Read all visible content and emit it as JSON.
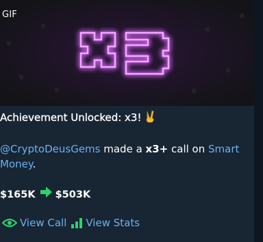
{
  "media": {
    "badge": "GIF",
    "image_text": "x3",
    "glow_color": "#d24cff"
  },
  "message": {
    "title": "Achievement Unlocked: x3!",
    "title_emoji": "victory-hand",
    "mention": "@CryptoDeusGems",
    "made_a": " made a ",
    "multiplier": "x3+",
    "call_on": " call on ",
    "channel": "Smart Money",
    "period": ".",
    "price_from": "$165K",
    "price_to": "$503K"
  },
  "actions": {
    "view_call": "View Call",
    "view_stats": "View Stats"
  },
  "colors": {
    "background": "#182533",
    "link": "#6ab2f2",
    "accent_green": "#2bd46b"
  }
}
